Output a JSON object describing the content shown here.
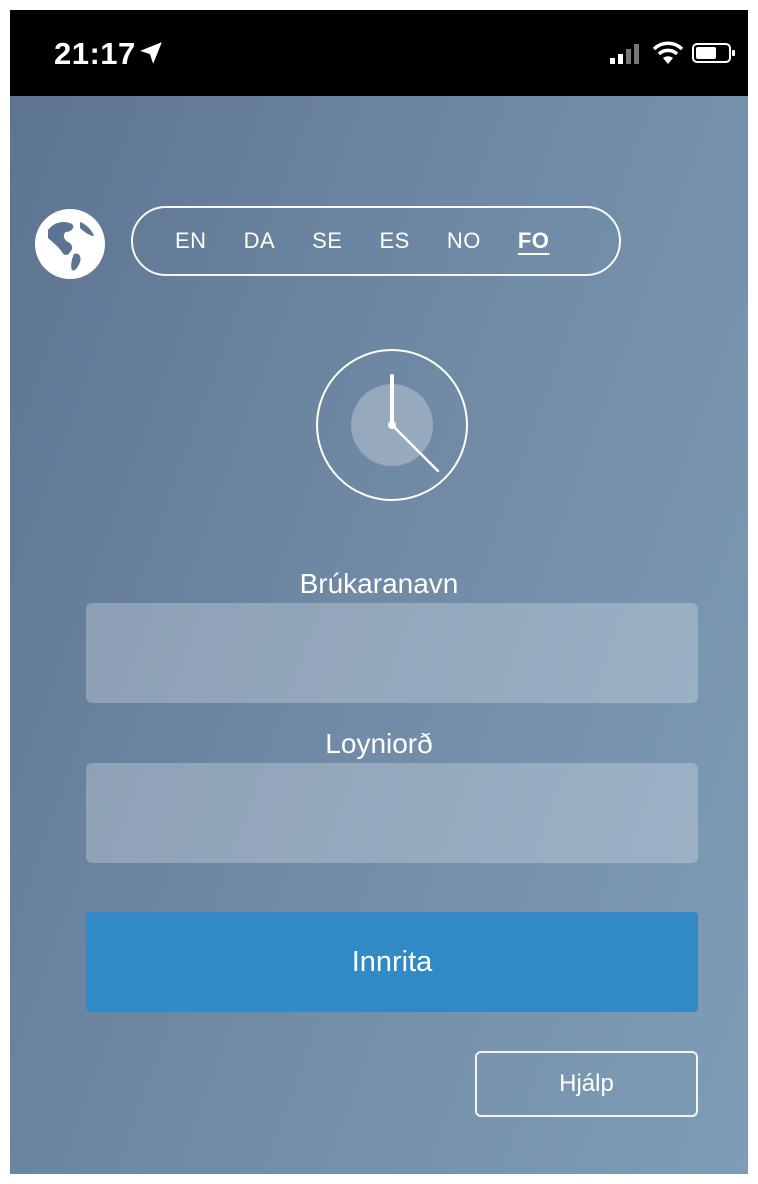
{
  "status_bar": {
    "time": "21:17",
    "location_icon": "location-arrow-icon",
    "signal_icon": "cellular-signal-icon",
    "wifi_icon": "wifi-icon",
    "battery_icon": "battery-icon"
  },
  "language": {
    "globe_icon": "globe-icon",
    "options": [
      "EN",
      "DA",
      "SE",
      "ES",
      "NO",
      "FO"
    ],
    "selected": "FO"
  },
  "logo": {
    "icon": "clock-icon"
  },
  "form": {
    "username_label": "Brúkaranavn",
    "username_value": "",
    "password_label": "Loyniorð",
    "password_value": "",
    "login_label": "Innrita",
    "help_label": "Hjálp"
  },
  "colors": {
    "background_start": "#5d7491",
    "background_end": "#7f9db6",
    "login_button": "#3189c6",
    "status_bar": "#000000"
  }
}
